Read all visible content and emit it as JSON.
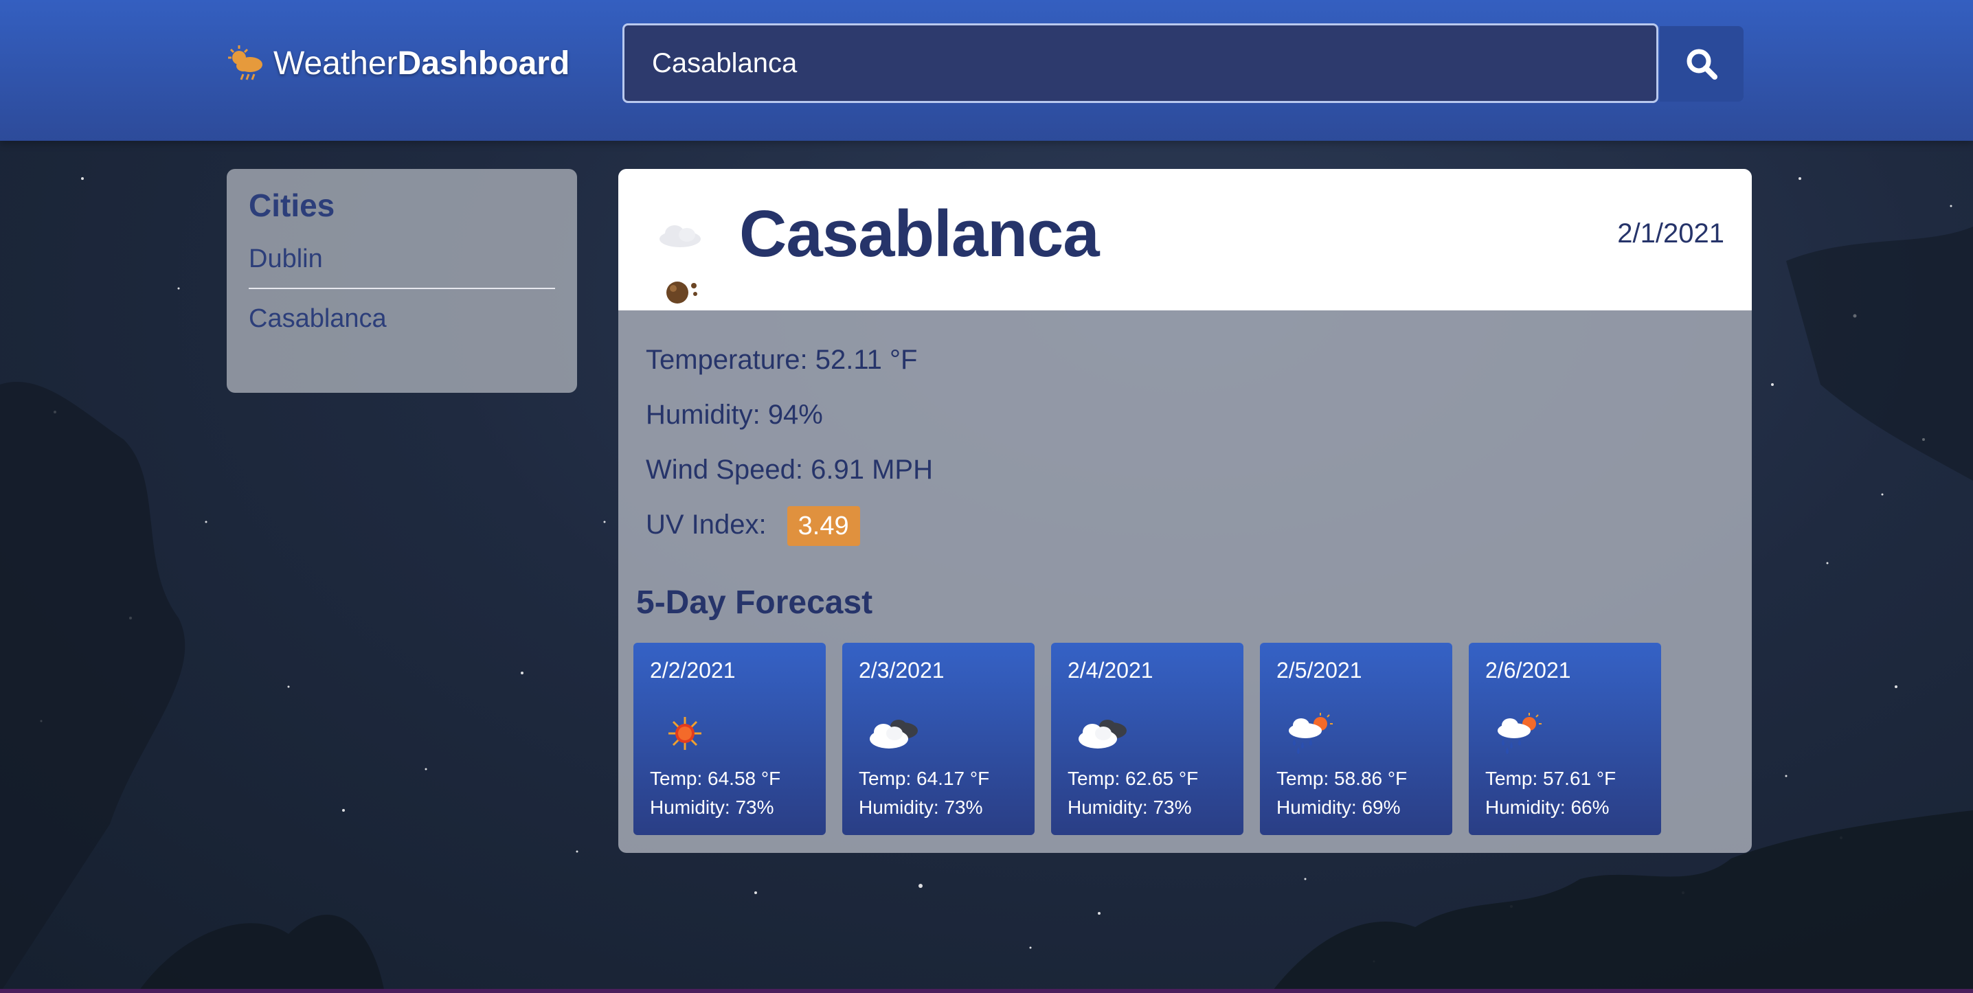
{
  "app": {
    "brand_regular": "Weather",
    "brand_bold": "Dashboard"
  },
  "search": {
    "value": "Casablanca",
    "button_icon": "search-icon"
  },
  "cities": {
    "title": "Cities",
    "items": [
      "Dublin",
      "Casablanca"
    ]
  },
  "current": {
    "icon": "night-clouds-icon",
    "city": "Casablanca",
    "date": "2/1/2021",
    "temperature": "Temperature: 52.11 °F",
    "humidity": "Humidity: 94%",
    "wind": "Wind Speed: 6.91 MPH",
    "uv_label": "UV Index:",
    "uv_value": "3.49",
    "uv_color": "#e0913e"
  },
  "forecast": {
    "title": "5-Day Forecast",
    "days": [
      {
        "date": "2/2/2021",
        "icon": "sun-icon",
        "temp": "Temp: 64.58 °F",
        "humidity": "Humidity: 73%"
      },
      {
        "date": "2/3/2021",
        "icon": "broken-clouds-icon",
        "temp": "Temp: 64.17 °F",
        "humidity": "Humidity: 73%"
      },
      {
        "date": "2/4/2021",
        "icon": "broken-clouds-icon",
        "temp": "Temp: 62.65 °F",
        "humidity": "Humidity: 73%"
      },
      {
        "date": "2/5/2021",
        "icon": "sun-rain-icon",
        "temp": "Temp: 58.86 °F",
        "humidity": "Humidity: 69%"
      },
      {
        "date": "2/6/2021",
        "icon": "sun-rain-icon",
        "temp": "Temp: 57.61 °F",
        "humidity": "Humidity: 66%"
      }
    ]
  },
  "colors": {
    "header": "#345fc0",
    "accent_text": "#26346a",
    "forecast_card": "#3562c6"
  }
}
